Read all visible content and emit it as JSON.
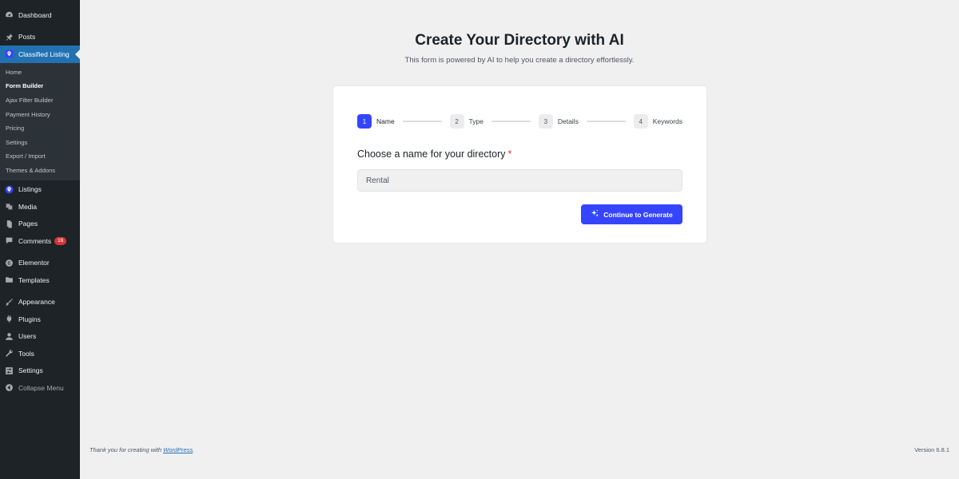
{
  "sidebar": {
    "top_items": [
      {
        "label": "Dashboard",
        "icon": "dashboard-icon"
      },
      {
        "label": "Posts",
        "icon": "pin-icon"
      },
      {
        "label": "Classified Listing",
        "icon": "map-pin-icon"
      }
    ],
    "submenu": [
      "Home",
      "Form Builder",
      "Ajax Filter Builder",
      "Payment History",
      "Pricing",
      "Settings",
      "Export / Import",
      "Themes & Addons"
    ],
    "items_a": [
      {
        "label": "Listings",
        "icon": "map-pin-icon"
      },
      {
        "label": "Media",
        "icon": "media-icon"
      },
      {
        "label": "Pages",
        "icon": "pages-icon"
      },
      {
        "label": "Comments",
        "icon": "comment-icon",
        "badge": "16"
      }
    ],
    "items_b": [
      {
        "label": "Elementor",
        "icon": "elementor-icon"
      },
      {
        "label": "Templates",
        "icon": "folder-icon"
      }
    ],
    "items_c": [
      {
        "label": "Appearance",
        "icon": "brush-icon"
      },
      {
        "label": "Plugins",
        "icon": "plugin-icon"
      },
      {
        "label": "Users",
        "icon": "user-icon"
      },
      {
        "label": "Tools",
        "icon": "wrench-icon"
      },
      {
        "label": "Settings",
        "icon": "settings-icon"
      }
    ],
    "collapse": "Collapse Menu"
  },
  "main": {
    "title": "Create Your Directory with AI",
    "subtitle": "This form is powered by AI to help you create a directory effortlessly.",
    "steps": [
      {
        "num": "1",
        "label": "Name"
      },
      {
        "num": "2",
        "label": "Type"
      },
      {
        "num": "3",
        "label": "Details"
      },
      {
        "num": "4",
        "label": "Keywords"
      }
    ],
    "field_label": "Choose a name for your directory",
    "required_mark": "*",
    "input_value": "Rental",
    "button_label": "Continue to Generate"
  },
  "footer": {
    "thanks_prefix": "Thank you for creating with ",
    "thanks_link": "WordPress",
    "thanks_suffix": ".",
    "version": "Version 6.8.1"
  },
  "colors": {
    "accent": "#3545ff",
    "sidebar_bg": "#1d2327",
    "sidebar_active": "#2271b1",
    "badge": "#d63638"
  }
}
